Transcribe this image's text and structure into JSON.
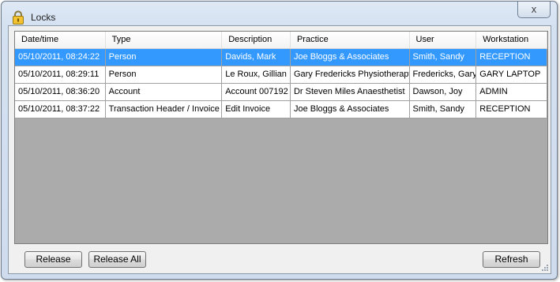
{
  "window": {
    "title": "Locks"
  },
  "icons": {
    "title_icon": "lock-icon",
    "close": "close-icon"
  },
  "close_glyph": "x",
  "grid": {
    "columns": [
      "Date/time",
      "Type",
      "Description",
      "Practice",
      "User",
      "Workstation"
    ],
    "rows": [
      [
        "05/10/2011, 08:24:22",
        "Person",
        "Davids, Mark",
        "Joe Bloggs & Associates",
        "Smith, Sandy",
        "RECEPTION"
      ],
      [
        "05/10/2011, 08:29:11",
        "Person",
        "Le Roux, Gillian",
        "Gary Fredericks Physiotherapy",
        "Fredericks, Gary",
        "GARY LAPTOP"
      ],
      [
        "05/10/2011, 08:36:20",
        "Account",
        "Account 007192",
        "Dr Steven Miles Anaesthetist",
        "Dawson, Joy",
        "ADMIN"
      ],
      [
        "05/10/2011, 08:37:22",
        "Transaction Header / Invoice",
        "Edit Invoice",
        "Joe Bloggs & Associates",
        "Smith, Sandy",
        "RECEPTION"
      ]
    ],
    "selected_row": 0
  },
  "buttons": {
    "release": "Release",
    "release_all": "Release All",
    "refresh": "Refresh"
  },
  "colors": {
    "selection": "#3399ff",
    "empty_area": "#ababab"
  }
}
